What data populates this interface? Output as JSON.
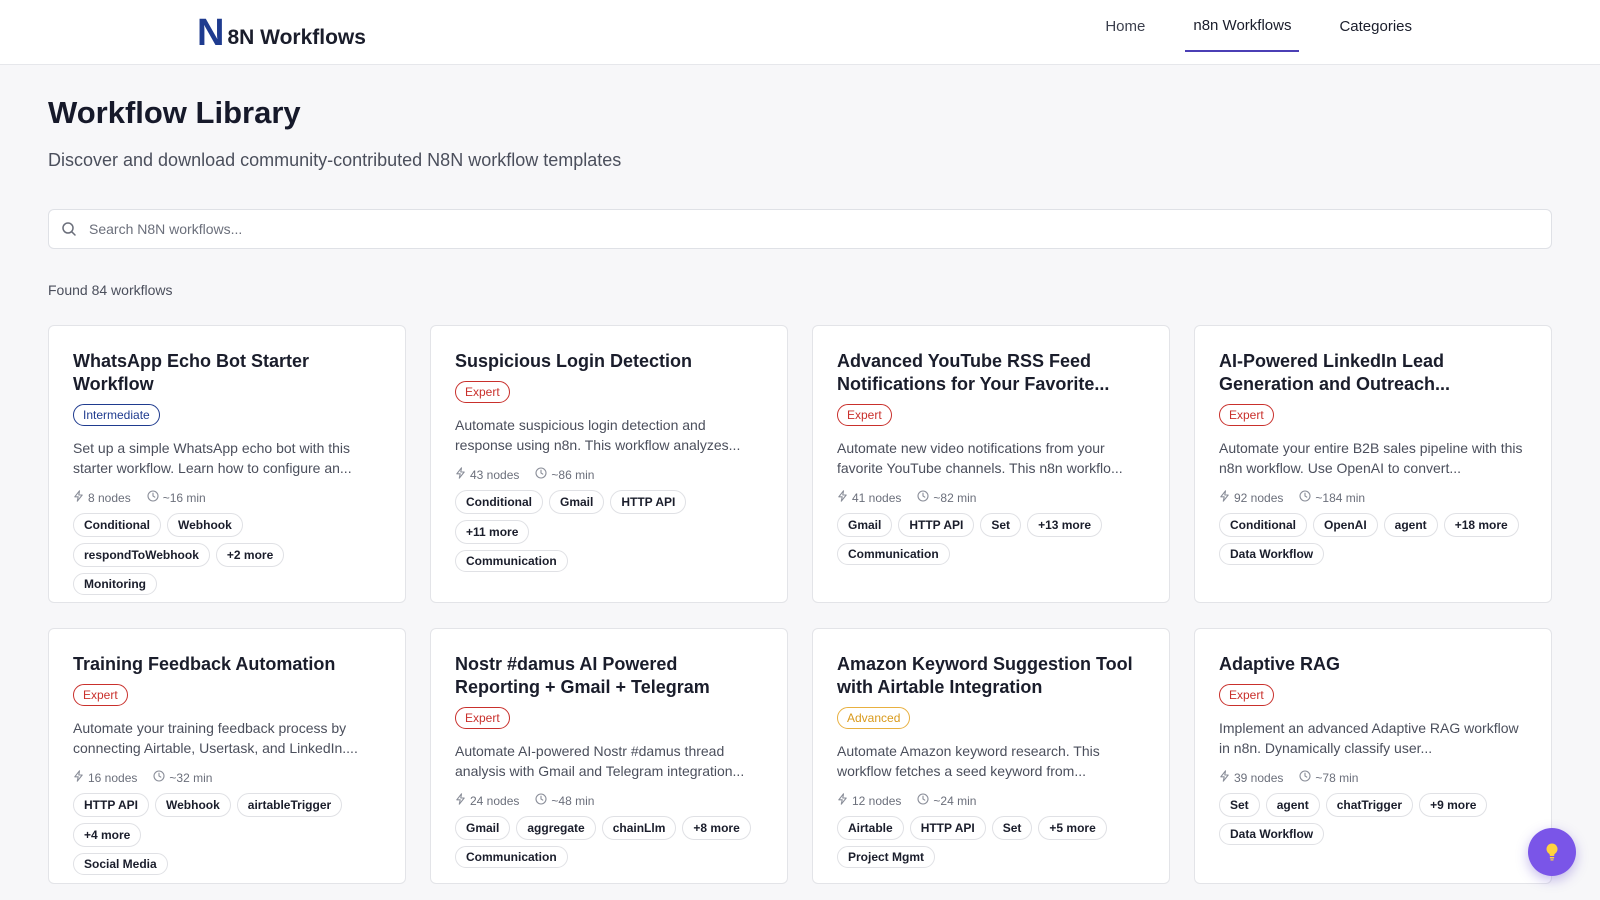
{
  "header": {
    "brand_mark": "N",
    "brand_text": "8N Workflows",
    "nav": [
      {
        "label": "Home",
        "active": false
      },
      {
        "label": "n8n Workflows",
        "active": true
      },
      {
        "label": "Categories",
        "active": false
      }
    ]
  },
  "page": {
    "title": "Workflow Library",
    "subtitle": "Discover and download community-contributed N8N workflow templates",
    "search_placeholder": "Search N8N workflows...",
    "results_count": "Found 84 workflows"
  },
  "cards": [
    {
      "title": "WhatsApp Echo Bot Starter Workflow",
      "level": "Intermediate",
      "level_style": "intermediate",
      "description": "Set up a simple WhatsApp echo bot with this starter workflow. Learn how to configure an...",
      "nodes": "8 nodes",
      "time": "~16 min",
      "tags": [
        "Conditional",
        "Webhook",
        "respondToWebhook",
        "+2 more"
      ],
      "category": "Monitoring"
    },
    {
      "title": "Suspicious Login Detection",
      "level": "Expert",
      "level_style": "expert",
      "description": "Automate suspicious login detection and response using n8n. This workflow analyzes...",
      "nodes": "43 nodes",
      "time": "~86 min",
      "tags": [
        "Conditional",
        "Gmail",
        "HTTP API",
        "+11 more"
      ],
      "category": "Communication"
    },
    {
      "title": "Advanced YouTube RSS Feed Notifications for Your Favorite...",
      "level": "Expert",
      "level_style": "expert",
      "description": "Automate new video notifications from your favorite YouTube channels. This n8n workflo...",
      "nodes": "41 nodes",
      "time": "~82 min",
      "tags": [
        "Gmail",
        "HTTP API",
        "Set",
        "+13 more"
      ],
      "category": "Communication"
    },
    {
      "title": "AI-Powered LinkedIn Lead Generation and Outreach...",
      "level": "Expert",
      "level_style": "expert",
      "description": "Automate your entire B2B sales pipeline with this n8n workflow. Use OpenAI to convert...",
      "nodes": "92 nodes",
      "time": "~184 min",
      "tags": [
        "Conditional",
        "OpenAI",
        "agent",
        "+18 more"
      ],
      "category": "Data Workflow"
    },
    {
      "title": "Training Feedback Automation",
      "level": "Expert",
      "level_style": "expert",
      "description": "Automate your training feedback process by connecting Airtable, Usertask, and LinkedIn....",
      "nodes": "16 nodes",
      "time": "~32 min",
      "tags": [
        "HTTP API",
        "Webhook",
        "airtableTrigger",
        "+4 more"
      ],
      "category": "Social Media"
    },
    {
      "title": "Nostr #damus AI Powered Reporting + Gmail + Telegram",
      "level": "Expert",
      "level_style": "expert",
      "description": "Automate AI-powered Nostr #damus thread analysis with Gmail and Telegram integration...",
      "nodes": "24 nodes",
      "time": "~48 min",
      "tags": [
        "Gmail",
        "aggregate",
        "chainLlm",
        "+8 more"
      ],
      "category": "Communication"
    },
    {
      "title": "Amazon Keyword Suggestion Tool with Airtable Integration",
      "level": "Advanced",
      "level_style": "advanced",
      "description": "Automate Amazon keyword research. This workflow fetches a seed keyword from...",
      "nodes": "12 nodes",
      "time": "~24 min",
      "tags": [
        "Airtable",
        "HTTP API",
        "Set",
        "+5 more"
      ],
      "category": "Project Mgmt"
    },
    {
      "title": "Adaptive RAG",
      "level": "Expert",
      "level_style": "expert",
      "description": "Implement an advanced Adaptive RAG workflow in n8n. Dynamically classify user...",
      "nodes": "39 nodes",
      "time": "~78 min",
      "tags": [
        "Set",
        "agent",
        "chatTrigger",
        "+9 more"
      ],
      "category": "Data Workflow"
    }
  ],
  "icons": {
    "search": "search-icon",
    "nodes": "zap-icon",
    "time": "clock-icon",
    "fab": "lightbulb-icon"
  },
  "colors": {
    "brand": "#1f3b8f",
    "nav_active": "#4b3fb5",
    "expert": "#c9302c",
    "intermediate": "#1f3b8f",
    "advanced": "#e8b040",
    "fab": "#7a55e8"
  }
}
